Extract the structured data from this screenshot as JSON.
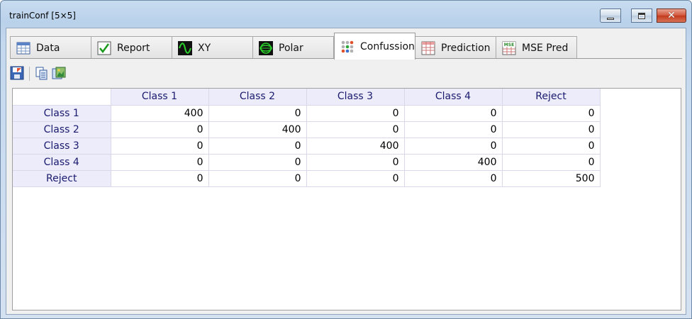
{
  "window": {
    "title": "trainConf [5×5]"
  },
  "tabs": [
    {
      "label": "Data",
      "icon": "table-icon",
      "active": false
    },
    {
      "label": "Report",
      "icon": "checkmark-icon",
      "active": false
    },
    {
      "label": "XY",
      "icon": "sine-wave-icon",
      "active": false
    },
    {
      "label": "Polar",
      "icon": "polar-plot-icon",
      "active": false
    },
    {
      "label": "Confussion",
      "icon": "dots-matrix-icon",
      "active": true
    },
    {
      "label": "Prediction",
      "icon": "grid-chart-icon",
      "active": false
    },
    {
      "label": "MSE Pred",
      "icon": "mse-icon",
      "active": false
    }
  ],
  "mse_icon_text": "MSE",
  "toolbar": {
    "buttons": [
      "save-icon",
      "copy-icon",
      "export-image-icon"
    ]
  },
  "matrix": {
    "columns": [
      "Class 1",
      "Class 2",
      "Class 3",
      "Class 4",
      "Reject"
    ],
    "rows": [
      {
        "label": "Class 1",
        "values": [
          "400",
          "0",
          "0",
          "0",
          "0"
        ]
      },
      {
        "label": "Class 2",
        "values": [
          "0",
          "400",
          "0",
          "0",
          "0"
        ]
      },
      {
        "label": "Class 3",
        "values": [
          "0",
          "0",
          "400",
          "0",
          "0"
        ]
      },
      {
        "label": "Class 4",
        "values": [
          "0",
          "0",
          "0",
          "400",
          "0"
        ]
      },
      {
        "label": "Reject",
        "values": [
          "0",
          "0",
          "0",
          "0",
          "500"
        ]
      }
    ]
  },
  "colors": {
    "header_bg": "#ececfb",
    "header_text": "#1a1a6e",
    "close_button": "#c23a1c"
  }
}
